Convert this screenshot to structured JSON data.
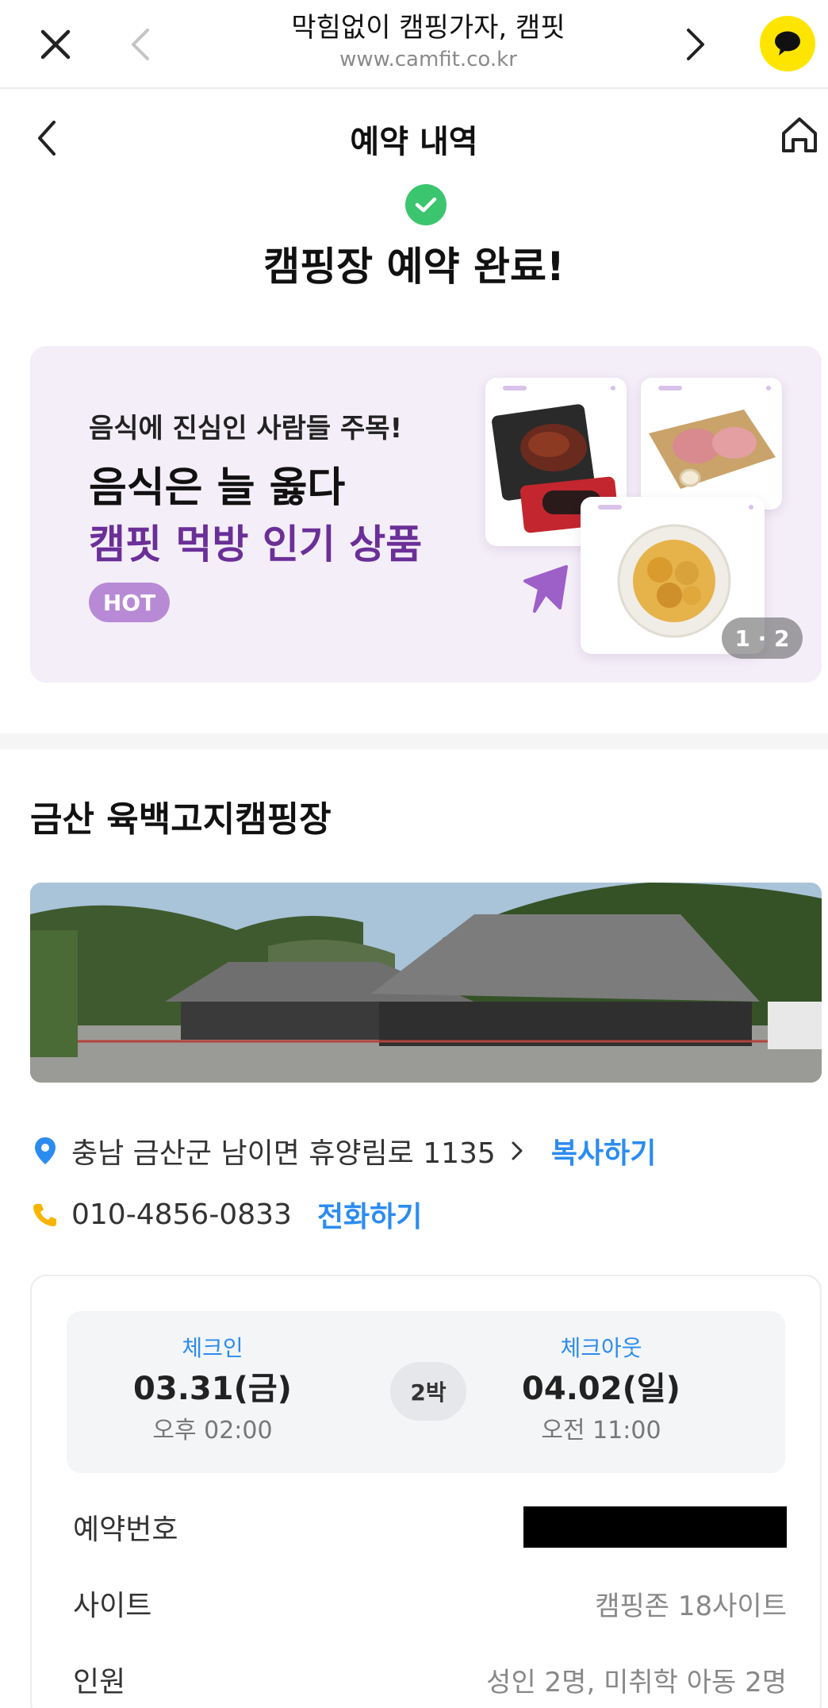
{
  "browser": {
    "title": "막힘없이 캠핑가자, 캠핏",
    "url": "www.camfit.co.kr",
    "icons": [
      "close-icon",
      "back-arrow-icon",
      "forward-arrow-icon",
      "kakaotalk-icon"
    ]
  },
  "header": {
    "title": "예약 내역",
    "icons": [
      "back-chevron-icon",
      "home-icon"
    ]
  },
  "confirmation": {
    "title": "캠핑장 예약 완료!",
    "icon": "check-circle-icon",
    "color": "#3cc56f"
  },
  "banner": {
    "subtitle": "음식에 진심인 사람들 주목!",
    "headline": "음식은 늘 옳다",
    "accent_line": "캠핏 먹방 인기 상품",
    "badge": "HOT",
    "counter": "1 · 2",
    "background": "#f4eef8",
    "accent_color": "#6b2f98"
  },
  "camp": {
    "name": "금산 육백고지캠핑장",
    "address": "충남 금산군 남이면 휴양림로 1135",
    "copy_label": "복사하기",
    "phone": "010-4856-0833",
    "call_label": "전화하기",
    "link_color": "#2b8cf0"
  },
  "reservation": {
    "checkin_label": "체크인",
    "checkin_date": "03.31(금)",
    "checkin_time": "오후 02:00",
    "nights": "2박",
    "checkout_label": "체크아웃",
    "checkout_date": "04.02(일)",
    "checkout_time": "오전 11:00",
    "rows": [
      {
        "label": "예약번호",
        "value": ""
      },
      {
        "label": "사이트",
        "value": "캠핑존 18사이트"
      },
      {
        "label": "인원",
        "value": "성인 2명, 미취학 아동 2명"
      }
    ]
  }
}
